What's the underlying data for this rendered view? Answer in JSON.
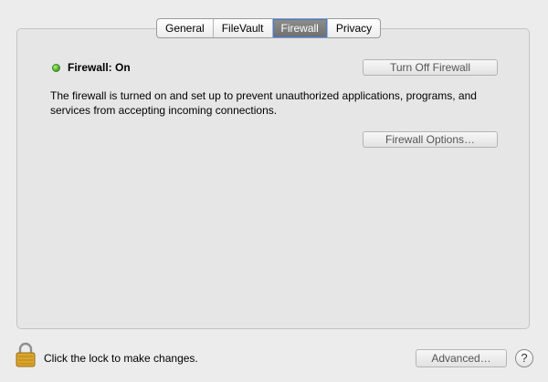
{
  "tabs": [
    {
      "label": "General",
      "active": false
    },
    {
      "label": "FileVault",
      "active": false
    },
    {
      "label": "Firewall",
      "active": true
    },
    {
      "label": "Privacy",
      "active": false
    }
  ],
  "firewall": {
    "status_label": "Firewall: On",
    "status_color": "#3fa21f",
    "turn_off_label": "Turn Off Firewall",
    "description": "The firewall is turned on and set up to prevent unauthorized applications, programs, and services from accepting incoming connections.",
    "options_label": "Firewall Options…"
  },
  "footer": {
    "lock_icon": "lock-icon",
    "lock_text": "Click the lock to make changes.",
    "advanced_label": "Advanced…",
    "help_label": "?"
  }
}
